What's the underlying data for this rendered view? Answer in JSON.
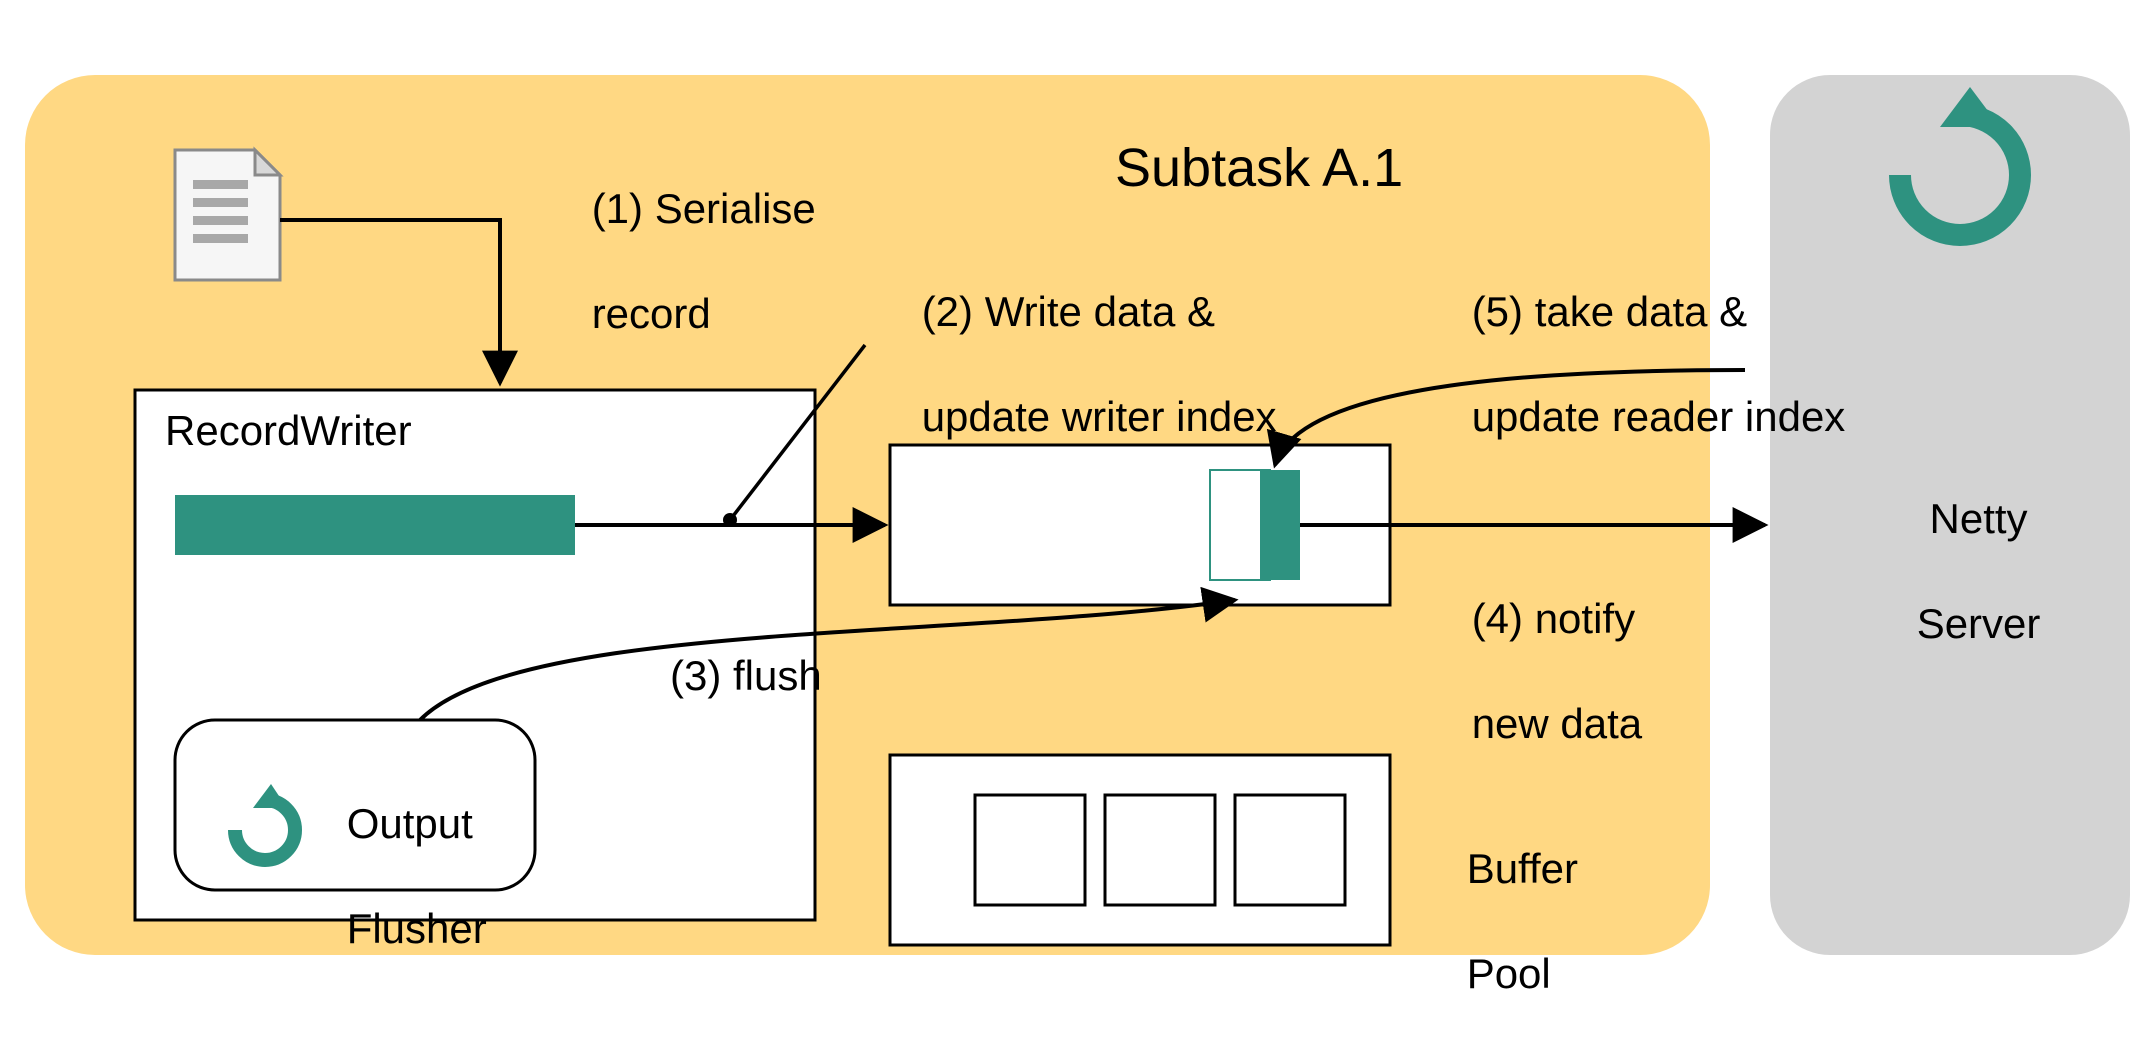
{
  "diagram": {
    "title": "Subtask A.1",
    "recordWriter": {
      "label": "RecordWriter"
    },
    "outputFlusher": {
      "line1": "Output",
      "line2": "Flusher"
    },
    "bufferPool": {
      "line1": "Buffer",
      "line2": "Pool"
    },
    "nettyServer": {
      "line1": "Netty",
      "line2": "Server"
    },
    "steps": {
      "s1": {
        "line1": "(1) Serialise",
        "line2": "record"
      },
      "s2": {
        "line1": "(2) Write data &",
        "line2": "update writer index"
      },
      "s3": "(3) flush",
      "s4": {
        "line1": "(4) notify",
        "line2": "new data"
      },
      "s5": {
        "line1": "(5) take data &",
        "line2": "update reader index"
      }
    }
  },
  "colors": {
    "subtaskBg": "#FFD883",
    "nettyBg": "#D3D3D3",
    "teal": "#2E9280",
    "line": "#000000"
  }
}
